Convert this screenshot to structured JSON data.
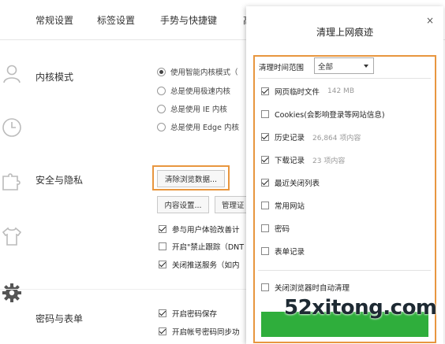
{
  "nav": {
    "tabs": [
      "常规设置",
      "标签设置",
      "手势与快捷键",
      "高"
    ]
  },
  "kernel": {
    "title": "内核模式",
    "options": [
      "使用智能内核模式（",
      "总是使用极速内核",
      "总是使用 IE 内核",
      "总是使用 Edge 内核"
    ],
    "selected_index": 0
  },
  "security": {
    "title": "安全与隐私",
    "clear_button": "清除浏览数据...",
    "content_button": "内容设置...",
    "manage_button": "管理证",
    "checks": [
      {
        "label": "参与用户体验改善计",
        "checked": true
      },
      {
        "label": "开启\"禁止跟踪（DNT",
        "checked": false
      },
      {
        "label": "关闭推送服务（如内",
        "checked": true
      }
    ]
  },
  "password": {
    "title": "密码与表单",
    "checks": [
      {
        "label": "开启密码保存",
        "checked": true
      },
      {
        "label": "开启帐号密码同步功",
        "checked": true
      }
    ]
  },
  "dialog": {
    "title": "清理上网痕迹",
    "close": "×",
    "range_label": "清理时间范围",
    "range_value": "全部",
    "items": [
      {
        "label": "网页临时文件",
        "extra": "142 MB",
        "checked": true
      },
      {
        "label": "Cookies(会影响登录等网站信息)",
        "extra": "",
        "checked": false
      },
      {
        "label": "历史记录",
        "extra": "26,864 项内容",
        "checked": true
      },
      {
        "label": "下载记录",
        "extra": "23 项内容",
        "checked": true
      },
      {
        "label": "最近关闭列表",
        "extra": "",
        "checked": true
      },
      {
        "label": "常用网站",
        "extra": "",
        "checked": false
      },
      {
        "label": "密码",
        "extra": "",
        "checked": false
      },
      {
        "label": "表单记录",
        "extra": "",
        "checked": false
      }
    ],
    "auto_clear": {
      "label": "关闭浏览器时自动清理",
      "checked": false
    },
    "accent": "#2fae3c"
  },
  "colors": {
    "highlight": "#e8963f"
  },
  "watermark": "52xitong.com",
  "icons": [
    "user-icon",
    "clock-icon",
    "puzzle-icon",
    "shirt-icon",
    "gear-icon"
  ]
}
